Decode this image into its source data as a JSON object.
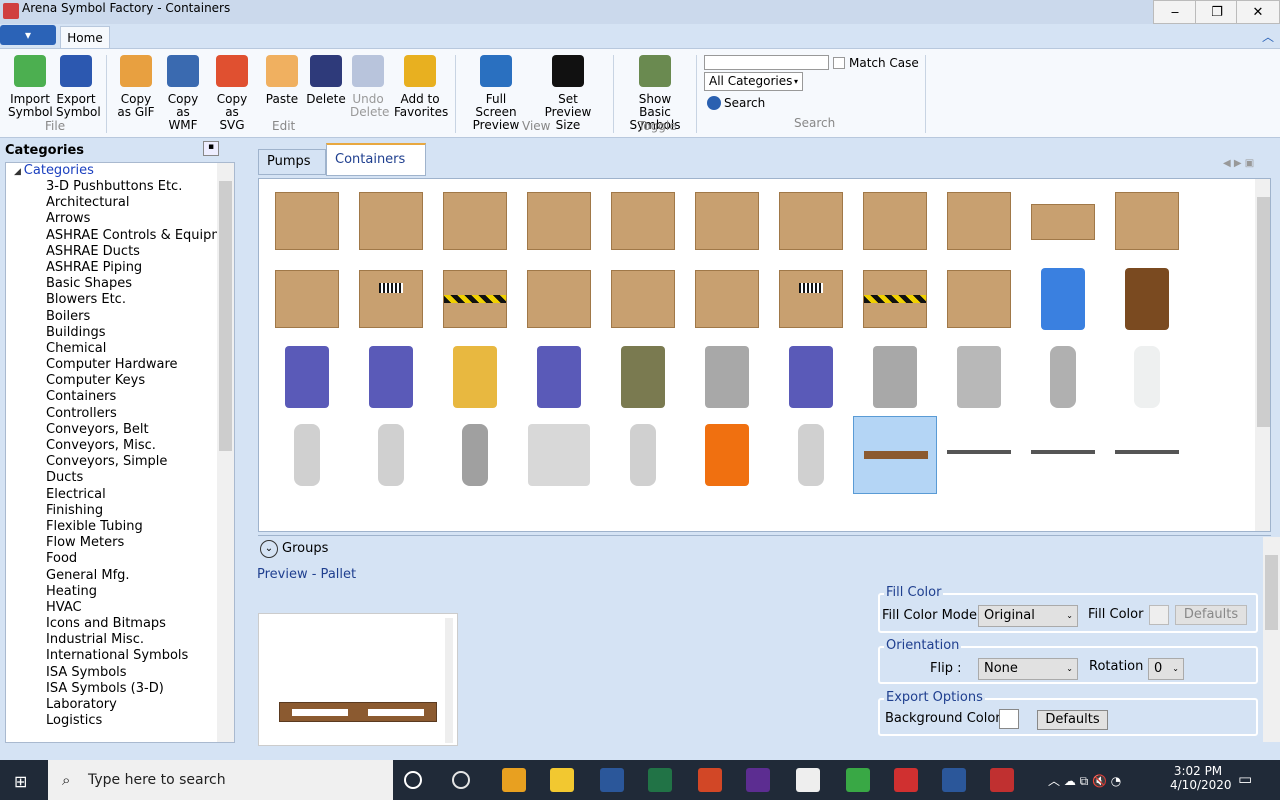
{
  "window": {
    "title": "Arena Symbol Factory - Containers",
    "minimize": "‒",
    "restore": "❐",
    "close": "✕"
  },
  "ribbon": {
    "tab": "Home",
    "app_menu": "▾",
    "buttons": [
      {
        "label1": "Import",
        "label2": "Symbol",
        "color": "#4caf50"
      },
      {
        "label1": "Export",
        "label2": "Symbol",
        "color": "#2c58b0"
      },
      {
        "label1": "Copy",
        "label2": "as GIF",
        "color": "#e8a040"
      },
      {
        "label1": "Copy as",
        "label2": "WMF",
        "color": "#3a6ab0"
      },
      {
        "label1": "Copy as",
        "label2": "SVG",
        "color": "#e05030"
      },
      {
        "label1": "Paste",
        "label2": "",
        "color": "#f0b060"
      },
      {
        "label1": "Delete",
        "label2": "",
        "color": "#2e3a7a"
      },
      {
        "label1": "Undo",
        "label2": "Delete",
        "color": "#b8c4dc",
        "disabled": true
      },
      {
        "label1": "Add to",
        "label2": "Favorites",
        "color": "#e8b020"
      },
      {
        "label1": "Full Screen",
        "label2": "Preview",
        "color": "#2a70c0"
      },
      {
        "label1": "Set",
        "label2": "Preview Size",
        "color": "#111111"
      },
      {
        "label1": "Show Basic",
        "label2": "Symbols",
        "color": "#6a8a50"
      }
    ],
    "groups": [
      "File",
      "Edit",
      "View",
      "Toggle",
      "Search"
    ],
    "search": {
      "value": "",
      "match_case": "Match Case",
      "category": "All Categories",
      "button": "Search"
    }
  },
  "sidebar": {
    "title": "Categories",
    "root": "Categories",
    "pin": "📌",
    "items": [
      "3-D Pushbuttons Etc.",
      "Architectural",
      "Arrows",
      "ASHRAE Controls & Equipment",
      "ASHRAE Ducts",
      "ASHRAE Piping",
      "Basic Shapes",
      "Blowers Etc.",
      "Boilers",
      "Buildings",
      "Chemical",
      "Computer Hardware",
      "Computer Keys",
      "Containers",
      "Controllers",
      "Conveyors, Belt",
      "Conveyors, Misc.",
      "Conveyors, Simple",
      "Ducts",
      "Electrical",
      "Finishing",
      "Flexible Tubing",
      "Flow Meters",
      "Food",
      "General Mfg.",
      "Heating",
      "HVAC",
      "Icons and Bitmaps",
      "Industrial Misc.",
      "International Symbols",
      "ISA Symbols",
      "ISA Symbols (3-D)",
      "Laboratory",
      "Logistics"
    ]
  },
  "tabs": [
    {
      "label": "Pumps"
    },
    {
      "label": "Containers",
      "active": true
    }
  ],
  "symbols": [
    [
      "crate",
      "crate",
      "box",
      "box-open",
      "box",
      "box-open",
      "box",
      "box",
      "box",
      "box-flat",
      "box"
    ],
    [
      "box",
      "box-label",
      "box-hazard",
      "box-open",
      "box",
      "box",
      "box-label",
      "box-hazard",
      "box-open",
      "blue-bin",
      "brown-drum"
    ],
    [
      "blue-barrel",
      "blue-barrel",
      "yellow-barrel",
      "blue-barrel",
      "green-barrel",
      "gray-barrel",
      "blue-barrel",
      "gray-barrel",
      "bucket",
      "gray-can",
      "glass-bottle"
    ],
    [
      "bottle",
      "bottle",
      "tall-bottle",
      "tank",
      "bottle",
      "orange-drum",
      "bottle",
      "pallet",
      "bar",
      "rack",
      "pallet-thin"
    ]
  ],
  "selected_symbol": "pallet",
  "groups_label": "Groups",
  "preview": {
    "label": "Preview - Pallet"
  },
  "fill": {
    "legend": "Fill Color",
    "mode_label": "Fill Color Mode",
    "mode": "Original",
    "color_label": "Fill Color",
    "defaults": "Defaults"
  },
  "orientation": {
    "legend": "Orientation",
    "flip_label": "Flip :",
    "flip": "None",
    "rotation_label": "Rotation :",
    "rotation": "0"
  },
  "export": {
    "legend": "Export Options",
    "bg_label": "Background Color",
    "defaults": "Defaults"
  },
  "taskbar": {
    "search_placeholder": "Type here to search",
    "time": "3:02 PM",
    "date": "4/10/2020",
    "apps": [
      "#ffffff",
      "#e5e5e5",
      "#e8a020",
      "#f2c830",
      "#2b579a",
      "#217346",
      "#d24726",
      "#5c2d91",
      "#eeeeee",
      "#39a845",
      "#d03030",
      "#2b579a",
      "#c03030"
    ]
  }
}
